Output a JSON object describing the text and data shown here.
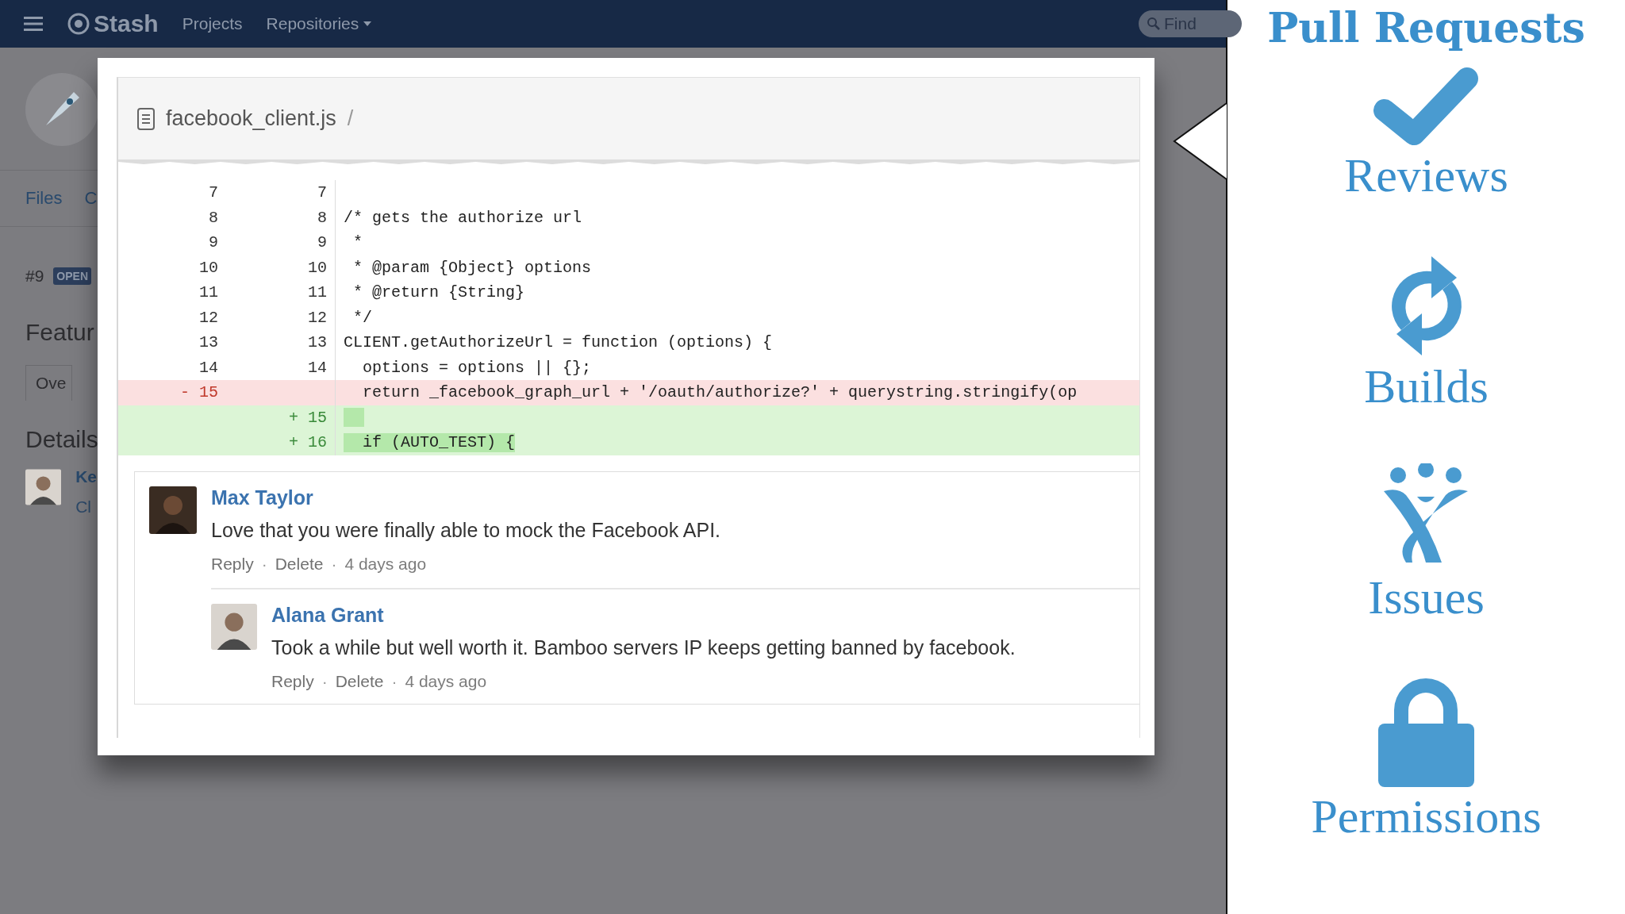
{
  "header": {
    "brand": "Stash",
    "nav": [
      {
        "label": "Projects",
        "kind": "link"
      },
      {
        "label": "Repositories",
        "kind": "dropdown"
      }
    ],
    "search": {
      "placeholder": "Find"
    }
  },
  "background_page": {
    "tabs": [
      "Files",
      "C"
    ],
    "pr_number": "#9",
    "status_badge": "OPEN",
    "title": "Featur",
    "tab": "Ove",
    "section_title": "Details",
    "reviewer_name": "Ke",
    "reviewer_line": "Cl"
  },
  "diff": {
    "file_name": "facebook_client.js",
    "path_separator": "/",
    "lines": [
      {
        "kind": "context",
        "old": "7",
        "new": "7"
      },
      {
        "kind": "context",
        "old": "8",
        "new": "8",
        "code": "/* gets the authorize url"
      },
      {
        "kind": "context",
        "old": "9",
        "new": "9",
        "code": " *"
      },
      {
        "kind": "context",
        "old": "10",
        "new": "10",
        "code": " * @param {Object} options"
      },
      {
        "kind": "context",
        "old": "11",
        "new": "11",
        "code": " * @return {String}"
      },
      {
        "kind": "context",
        "old": "12",
        "new": "12",
        "code": " */"
      },
      {
        "kind": "context",
        "old": "13",
        "new": "13",
        "code": "CLIENT.getAuthorizeUrl = function (options) {"
      },
      {
        "kind": "context",
        "old": "14",
        "new": "14",
        "code": "  options = options || {};"
      },
      {
        "kind": "removed",
        "old": "- 15",
        "code": "  return _facebook_graph_url + '/oauth/authorize?' + querystring.stringify(op"
      },
      {
        "kind": "added",
        "new": "+ 15",
        "highlight": true
      },
      {
        "kind": "added",
        "new": "+ 16",
        "code": "  if (AUTO_TEST) {",
        "highlight": true
      }
    ]
  },
  "comments": [
    {
      "author": "Max Taylor",
      "text": "Love that you were finally able to mock the Facebook API.",
      "actions": [
        {
          "kind": "link",
          "text": "Reply"
        },
        {
          "kind": "dot",
          "text": "·"
        },
        {
          "kind": "link",
          "text": "Delete"
        },
        {
          "kind": "dot",
          "text": "·"
        },
        {
          "kind": "time",
          "text": "4 days ago"
        }
      ],
      "replies": [
        {
          "author": "Alana Grant",
          "text": "Took a while but well worth it. Bamboo servers IP keeps getting banned by facebook.",
          "actions": [
            {
              "kind": "link",
              "text": "Reply"
            },
            {
              "kind": "dot",
              "text": "·"
            },
            {
              "kind": "link",
              "text": "Delete"
            },
            {
              "kind": "dot",
              "text": "·"
            },
            {
              "kind": "time",
              "text": "4 days ago"
            }
          ]
        }
      ]
    }
  ],
  "feature_panel": {
    "title": "Pull Requests",
    "features": [
      {
        "kind": "check",
        "label": "Reviews"
      },
      {
        "kind": "sync",
        "label": "Builds"
      },
      {
        "kind": "people",
        "label": "Issues"
      },
      {
        "kind": "lock",
        "label": "Permissions"
      }
    ]
  }
}
